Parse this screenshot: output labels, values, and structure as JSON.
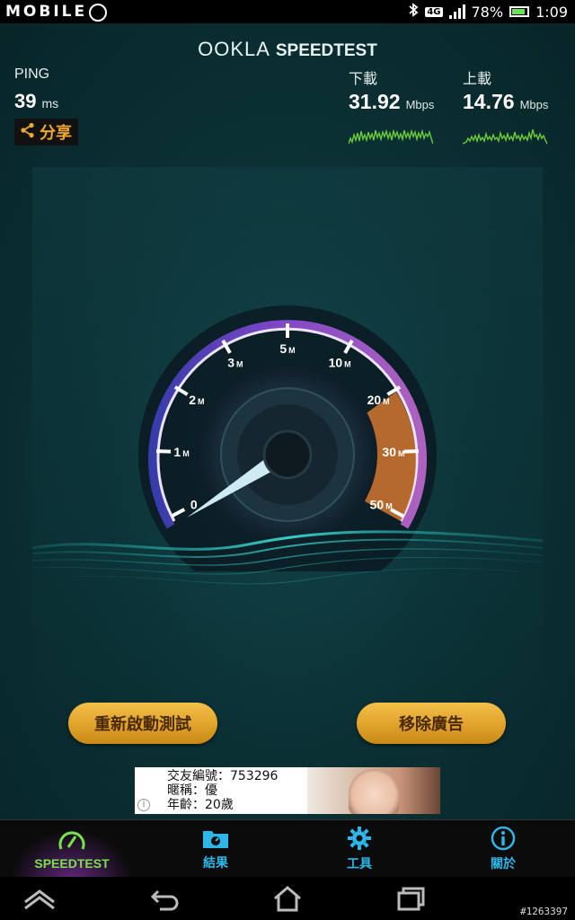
{
  "status_bar": {
    "watermark": "MOBILE",
    "network": "4G",
    "battery": "78%",
    "time": "1:09"
  },
  "app": {
    "brand_ookla": "OOKLA",
    "brand_speedtest": "SPEEDTEST",
    "ping": {
      "label": "PING",
      "value": "39",
      "unit": "ms"
    },
    "share_label": "分享",
    "download": {
      "label": "下載",
      "value": "31.92",
      "unit": "Mbps"
    },
    "upload": {
      "label": "上載",
      "value": "14.76",
      "unit": "Mbps"
    },
    "gauge": {
      "ticks": [
        {
          "num": "0",
          "suf": ""
        },
        {
          "num": "1",
          "suf": "M"
        },
        {
          "num": "2",
          "suf": "M"
        },
        {
          "num": "3",
          "suf": "M"
        },
        {
          "num": "5",
          "suf": "M"
        },
        {
          "num": "10",
          "suf": "M"
        },
        {
          "num": "20",
          "suf": "M"
        },
        {
          "num": "30",
          "suf": "M"
        },
        {
          "num": "50",
          "suf": "M"
        }
      ]
    },
    "restart_button": "重新啟動測試",
    "remove_ads_button": "移除廣告",
    "ad": {
      "line1": "交友編號：753296",
      "line2": "暱稱：優",
      "line3": "年齡：20歲",
      "info": "i"
    }
  },
  "tabs": [
    {
      "label": "SPEEDTEST",
      "icon": "gauge-icon",
      "active": true
    },
    {
      "label": "結果",
      "icon": "folder-icon",
      "active": false
    },
    {
      "label": "工具",
      "icon": "gear-icon",
      "active": false
    },
    {
      "label": "關於",
      "icon": "info-icon",
      "active": false
    }
  ],
  "credit": "#1263397",
  "colors": {
    "accent_green": "#7be04a",
    "accent_blue": "#2eb6e8",
    "button_gold": "#e0a22a"
  }
}
